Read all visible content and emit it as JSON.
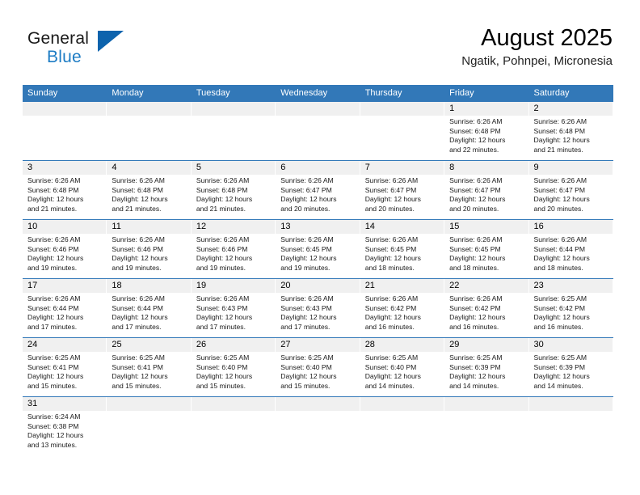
{
  "brand": {
    "name_part1": "General",
    "name_part2": "Blue",
    "triangle_color": "#0d63ad",
    "blue_text_color": "#1d7cc4"
  },
  "header": {
    "month_title": "August 2025",
    "location": "Ngatik, Pohnpei, Micronesia"
  },
  "theme": {
    "header_blue": "#3278b8",
    "day_number_bg": "#f0f0f0",
    "page_bg": "#ffffff"
  },
  "weekdays": [
    "Sunday",
    "Monday",
    "Tuesday",
    "Wednesday",
    "Thursday",
    "Friday",
    "Saturday"
  ],
  "weeks": [
    {
      "days": [
        {
          "empty": true
        },
        {
          "empty": true
        },
        {
          "empty": true
        },
        {
          "empty": true
        },
        {
          "empty": true
        },
        {
          "empty": false,
          "number": "1",
          "sunrise": "Sunrise: 6:26 AM",
          "sunset": "Sunset: 6:48 PM",
          "daylight_line1": "Daylight: 12 hours",
          "daylight_line2": "and 22 minutes."
        },
        {
          "empty": false,
          "number": "2",
          "sunrise": "Sunrise: 6:26 AM",
          "sunset": "Sunset: 6:48 PM",
          "daylight_line1": "Daylight: 12 hours",
          "daylight_line2": "and 21 minutes."
        }
      ]
    },
    {
      "days": [
        {
          "empty": false,
          "number": "3",
          "sunrise": "Sunrise: 6:26 AM",
          "sunset": "Sunset: 6:48 PM",
          "daylight_line1": "Daylight: 12 hours",
          "daylight_line2": "and 21 minutes."
        },
        {
          "empty": false,
          "number": "4",
          "sunrise": "Sunrise: 6:26 AM",
          "sunset": "Sunset: 6:48 PM",
          "daylight_line1": "Daylight: 12 hours",
          "daylight_line2": "and 21 minutes."
        },
        {
          "empty": false,
          "number": "5",
          "sunrise": "Sunrise: 6:26 AM",
          "sunset": "Sunset: 6:48 PM",
          "daylight_line1": "Daylight: 12 hours",
          "daylight_line2": "and 21 minutes."
        },
        {
          "empty": false,
          "number": "6",
          "sunrise": "Sunrise: 6:26 AM",
          "sunset": "Sunset: 6:47 PM",
          "daylight_line1": "Daylight: 12 hours",
          "daylight_line2": "and 20 minutes."
        },
        {
          "empty": false,
          "number": "7",
          "sunrise": "Sunrise: 6:26 AM",
          "sunset": "Sunset: 6:47 PM",
          "daylight_line1": "Daylight: 12 hours",
          "daylight_line2": "and 20 minutes."
        },
        {
          "empty": false,
          "number": "8",
          "sunrise": "Sunrise: 6:26 AM",
          "sunset": "Sunset: 6:47 PM",
          "daylight_line1": "Daylight: 12 hours",
          "daylight_line2": "and 20 minutes."
        },
        {
          "empty": false,
          "number": "9",
          "sunrise": "Sunrise: 6:26 AM",
          "sunset": "Sunset: 6:47 PM",
          "daylight_line1": "Daylight: 12 hours",
          "daylight_line2": "and 20 minutes."
        }
      ]
    },
    {
      "days": [
        {
          "empty": false,
          "number": "10",
          "sunrise": "Sunrise: 6:26 AM",
          "sunset": "Sunset: 6:46 PM",
          "daylight_line1": "Daylight: 12 hours",
          "daylight_line2": "and 19 minutes."
        },
        {
          "empty": false,
          "number": "11",
          "sunrise": "Sunrise: 6:26 AM",
          "sunset": "Sunset: 6:46 PM",
          "daylight_line1": "Daylight: 12 hours",
          "daylight_line2": "and 19 minutes."
        },
        {
          "empty": false,
          "number": "12",
          "sunrise": "Sunrise: 6:26 AM",
          "sunset": "Sunset: 6:46 PM",
          "daylight_line1": "Daylight: 12 hours",
          "daylight_line2": "and 19 minutes."
        },
        {
          "empty": false,
          "number": "13",
          "sunrise": "Sunrise: 6:26 AM",
          "sunset": "Sunset: 6:45 PM",
          "daylight_line1": "Daylight: 12 hours",
          "daylight_line2": "and 19 minutes."
        },
        {
          "empty": false,
          "number": "14",
          "sunrise": "Sunrise: 6:26 AM",
          "sunset": "Sunset: 6:45 PM",
          "daylight_line1": "Daylight: 12 hours",
          "daylight_line2": "and 18 minutes."
        },
        {
          "empty": false,
          "number": "15",
          "sunrise": "Sunrise: 6:26 AM",
          "sunset": "Sunset: 6:45 PM",
          "daylight_line1": "Daylight: 12 hours",
          "daylight_line2": "and 18 minutes."
        },
        {
          "empty": false,
          "number": "16",
          "sunrise": "Sunrise: 6:26 AM",
          "sunset": "Sunset: 6:44 PM",
          "daylight_line1": "Daylight: 12 hours",
          "daylight_line2": "and 18 minutes."
        }
      ]
    },
    {
      "days": [
        {
          "empty": false,
          "number": "17",
          "sunrise": "Sunrise: 6:26 AM",
          "sunset": "Sunset: 6:44 PM",
          "daylight_line1": "Daylight: 12 hours",
          "daylight_line2": "and 17 minutes."
        },
        {
          "empty": false,
          "number": "18",
          "sunrise": "Sunrise: 6:26 AM",
          "sunset": "Sunset: 6:44 PM",
          "daylight_line1": "Daylight: 12 hours",
          "daylight_line2": "and 17 minutes."
        },
        {
          "empty": false,
          "number": "19",
          "sunrise": "Sunrise: 6:26 AM",
          "sunset": "Sunset: 6:43 PM",
          "daylight_line1": "Daylight: 12 hours",
          "daylight_line2": "and 17 minutes."
        },
        {
          "empty": false,
          "number": "20",
          "sunrise": "Sunrise: 6:26 AM",
          "sunset": "Sunset: 6:43 PM",
          "daylight_line1": "Daylight: 12 hours",
          "daylight_line2": "and 17 minutes."
        },
        {
          "empty": false,
          "number": "21",
          "sunrise": "Sunrise: 6:26 AM",
          "sunset": "Sunset: 6:42 PM",
          "daylight_line1": "Daylight: 12 hours",
          "daylight_line2": "and 16 minutes."
        },
        {
          "empty": false,
          "number": "22",
          "sunrise": "Sunrise: 6:26 AM",
          "sunset": "Sunset: 6:42 PM",
          "daylight_line1": "Daylight: 12 hours",
          "daylight_line2": "and 16 minutes."
        },
        {
          "empty": false,
          "number": "23",
          "sunrise": "Sunrise: 6:25 AM",
          "sunset": "Sunset: 6:42 PM",
          "daylight_line1": "Daylight: 12 hours",
          "daylight_line2": "and 16 minutes."
        }
      ]
    },
    {
      "days": [
        {
          "empty": false,
          "number": "24",
          "sunrise": "Sunrise: 6:25 AM",
          "sunset": "Sunset: 6:41 PM",
          "daylight_line1": "Daylight: 12 hours",
          "daylight_line2": "and 15 minutes."
        },
        {
          "empty": false,
          "number": "25",
          "sunrise": "Sunrise: 6:25 AM",
          "sunset": "Sunset: 6:41 PM",
          "daylight_line1": "Daylight: 12 hours",
          "daylight_line2": "and 15 minutes."
        },
        {
          "empty": false,
          "number": "26",
          "sunrise": "Sunrise: 6:25 AM",
          "sunset": "Sunset: 6:40 PM",
          "daylight_line1": "Daylight: 12 hours",
          "daylight_line2": "and 15 minutes."
        },
        {
          "empty": false,
          "number": "27",
          "sunrise": "Sunrise: 6:25 AM",
          "sunset": "Sunset: 6:40 PM",
          "daylight_line1": "Daylight: 12 hours",
          "daylight_line2": "and 15 minutes."
        },
        {
          "empty": false,
          "number": "28",
          "sunrise": "Sunrise: 6:25 AM",
          "sunset": "Sunset: 6:40 PM",
          "daylight_line1": "Daylight: 12 hours",
          "daylight_line2": "and 14 minutes."
        },
        {
          "empty": false,
          "number": "29",
          "sunrise": "Sunrise: 6:25 AM",
          "sunset": "Sunset: 6:39 PM",
          "daylight_line1": "Daylight: 12 hours",
          "daylight_line2": "and 14 minutes."
        },
        {
          "empty": false,
          "number": "30",
          "sunrise": "Sunrise: 6:25 AM",
          "sunset": "Sunset: 6:39 PM",
          "daylight_line1": "Daylight: 12 hours",
          "daylight_line2": "and 14 minutes."
        }
      ]
    },
    {
      "days": [
        {
          "empty": false,
          "number": "31",
          "sunrise": "Sunrise: 6:24 AM",
          "sunset": "Sunset: 6:38 PM",
          "daylight_line1": "Daylight: 12 hours",
          "daylight_line2": "and 13 minutes."
        },
        {
          "empty": true
        },
        {
          "empty": true
        },
        {
          "empty": true
        },
        {
          "empty": true
        },
        {
          "empty": true
        },
        {
          "empty": true
        }
      ]
    }
  ]
}
